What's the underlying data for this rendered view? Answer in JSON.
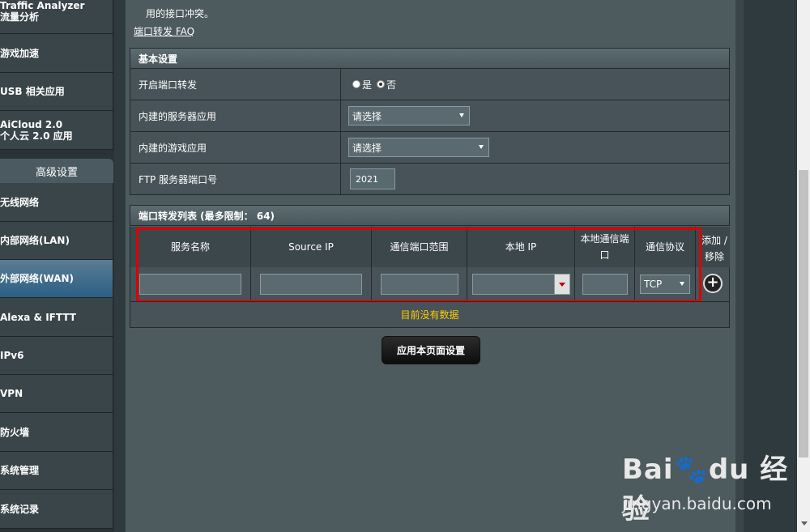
{
  "sidebar": {
    "items_top": [
      {
        "line1": "Traffic Analyzer",
        "line2": "流量分析"
      },
      {
        "line1": "游戏加速",
        "line2": ""
      },
      {
        "line1": "USB 相关应用",
        "line2": ""
      },
      {
        "line1": "AiCloud 2.0",
        "line2": "个人云 2.0 应用"
      }
    ],
    "advanced_header": "高级设置",
    "items_advanced": [
      "无线网络",
      "内部网络(LAN)",
      "外部网络(WAN)",
      "Alexa & IFTTT",
      "IPv6",
      "VPN",
      "防火墙",
      "系统管理",
      "系统记录"
    ],
    "active_item": "外部网络(WAN)"
  },
  "main": {
    "note_text": "用的接口冲突。",
    "faq_link": "端口转发  FAQ",
    "basic_settings": {
      "title": "基本设置",
      "enable_label": "开启端口转发",
      "radio_yes": "是",
      "radio_no": "否",
      "selected": "否",
      "server_app_label": "内建的服务器应用",
      "server_app_value": "请选择",
      "game_app_label": "内建的游戏应用",
      "game_app_value": "请选择",
      "ftp_label": "FTP 服务器端口号",
      "ftp_value": "2021"
    },
    "pf_list": {
      "title": "端口转发列表 (最多限制： 64)",
      "columns": [
        "服务名称",
        "Source IP",
        "通信端口范围",
        "本地 IP",
        "本地通信端口",
        "通信协议"
      ],
      "add_remove": "添加 / 移除",
      "protocol_value": "TCP",
      "empty_text": "目前没有数据"
    },
    "apply_button": "应用本页面设置"
  },
  "watermark": {
    "brand": "Bai🐾du 经验",
    "site": "jingyan.baidu.com"
  }
}
